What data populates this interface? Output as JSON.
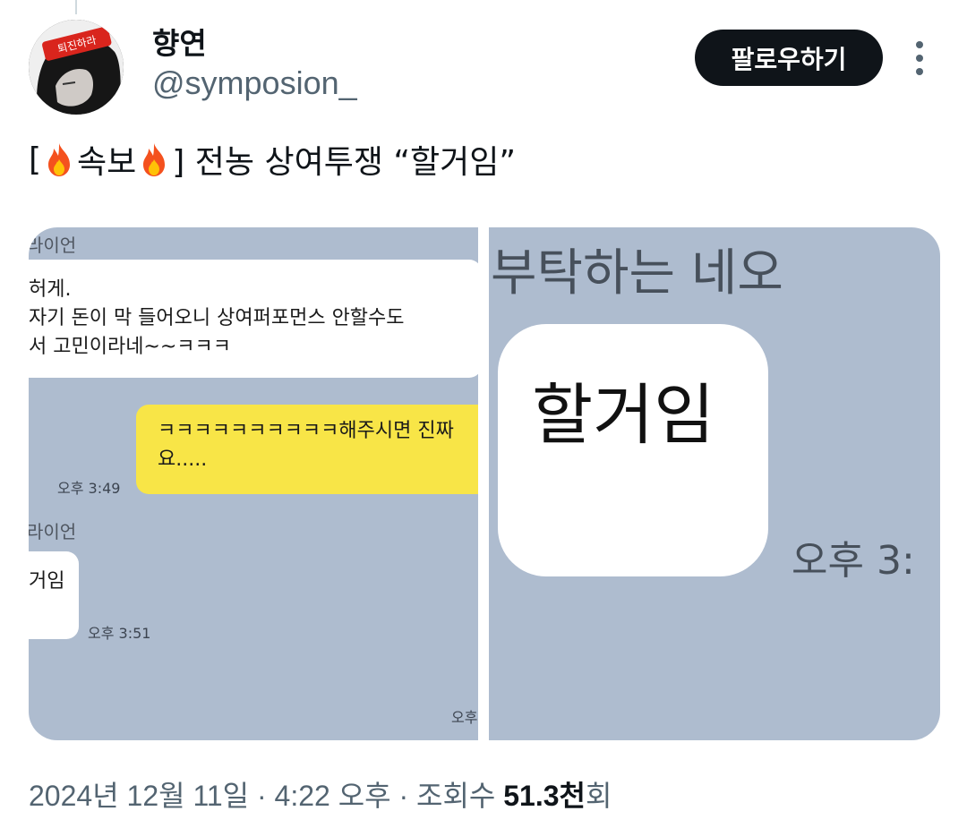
{
  "author": {
    "name": "향연",
    "handle": "@symposion_",
    "avatar_band_text": "퇴진하라"
  },
  "actions": {
    "follow_label": "팔로우하기",
    "more_icon": "more-vertical-icon"
  },
  "post": {
    "text_open": "[",
    "emoji_1": "fire-emoji",
    "text_mid": "속보",
    "emoji_2": "fire-emoji",
    "text_close": "] 전농 상여투쟁 “할거임”"
  },
  "media": {
    "left": {
      "sender_1": "라이언",
      "msg_1_lines": [
        "허게.",
        "자기 돈이 막 들어오니 상여퍼포먼스 안할수도",
        "서 고민이라네~~ㅋㅋㅋ"
      ],
      "reply_lines": [
        "ㅋㅋㅋㅋㅋㅋㅋㅋㅋㅋ해주시면 진짜",
        "요....."
      ],
      "reply_time": "오후 3:49",
      "sender_2": "라이언",
      "msg_2": "거임",
      "msg_2_time": "오후 3:51",
      "bottom_time": "오후"
    },
    "right": {
      "sender": "부탁하는 네오",
      "message": "할거임",
      "time": "오후 3:"
    }
  },
  "meta": {
    "datetime": "2024년 12월 11일 · 4:22 오후 · 조회수 ",
    "views_value": "51.3천",
    "views_suffix": "회"
  },
  "colors": {
    "follow_bg": "#0f1419",
    "chat_bg": "#aebccf",
    "yellow_bubble": "#f8e547",
    "secondary_text": "#536471",
    "avatar_band": "#d9251d"
  }
}
